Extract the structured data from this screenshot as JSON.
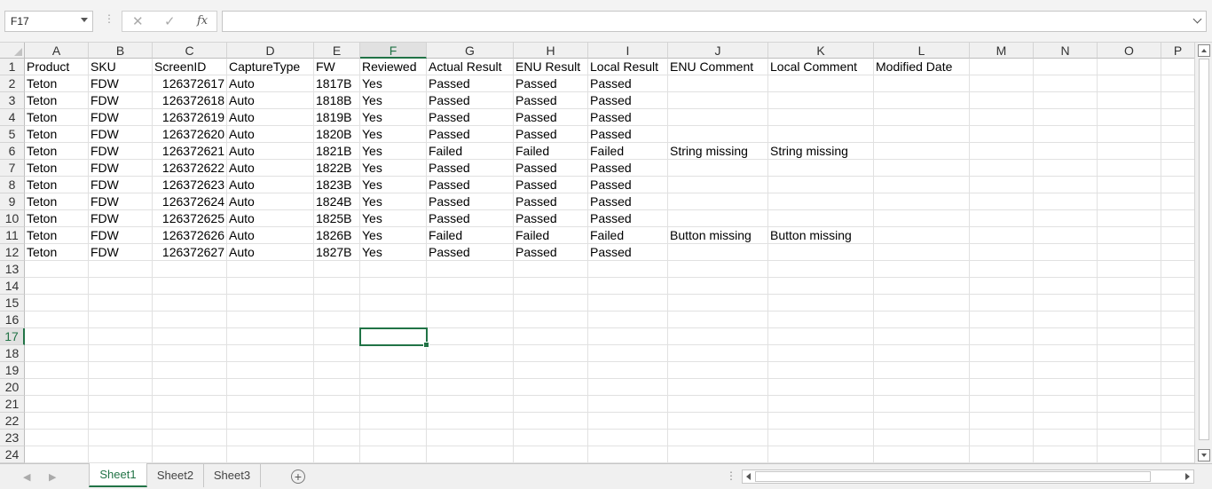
{
  "formula_bar": {
    "name_box": "F17",
    "formula": "",
    "fx_label": "fx",
    "cancel_glyph": "✕",
    "enter_glyph": "✓"
  },
  "columns": [
    "A",
    "B",
    "C",
    "D",
    "E",
    "F",
    "G",
    "H",
    "I",
    "J",
    "K",
    "L",
    "M",
    "N",
    "O",
    "P"
  ],
  "active_column": "F",
  "active_row": 17,
  "row_numbers": [
    1,
    2,
    3,
    4,
    5,
    6,
    7,
    8,
    9,
    10,
    11,
    12,
    13,
    14,
    15,
    16,
    17,
    18,
    19,
    20,
    21,
    22,
    23,
    24
  ],
  "rows": [
    [
      "Product",
      "SKU",
      "ScreenID",
      "CaptureType",
      "FW",
      "Reviewed",
      "Actual Result",
      "ENU Result",
      "Local Result",
      "ENU Comment",
      "Local Comment",
      "Modified Date"
    ],
    [
      "Teton",
      "FDW",
      "126372617",
      "Auto",
      "1817B",
      "Yes",
      "Passed",
      "Passed",
      "Passed",
      "",
      "",
      ""
    ],
    [
      "Teton",
      "FDW",
      "126372618",
      "Auto",
      "1818B",
      "Yes",
      "Passed",
      "Passed",
      "Passed",
      "",
      "",
      ""
    ],
    [
      "Teton",
      "FDW",
      "126372619",
      "Auto",
      "1819B",
      "Yes",
      "Passed",
      "Passed",
      "Passed",
      "",
      "",
      ""
    ],
    [
      "Teton",
      "FDW",
      "126372620",
      "Auto",
      "1820B",
      "Yes",
      "Passed",
      "Passed",
      "Passed",
      "",
      "",
      ""
    ],
    [
      "Teton",
      "FDW",
      "126372621",
      "Auto",
      "1821B",
      "Yes",
      "Failed",
      "Failed",
      "Failed",
      "String missing",
      "String missing",
      ""
    ],
    [
      "Teton",
      "FDW",
      "126372622",
      "Auto",
      "1822B",
      "Yes",
      "Passed",
      "Passed",
      "Passed",
      "",
      "",
      ""
    ],
    [
      "Teton",
      "FDW",
      "126372623",
      "Auto",
      "1823B",
      "Yes",
      "Passed",
      "Passed",
      "Passed",
      "",
      "",
      ""
    ],
    [
      "Teton",
      "FDW",
      "126372624",
      "Auto",
      "1824B",
      "Yes",
      "Passed",
      "Passed",
      "Passed",
      "",
      "",
      ""
    ],
    [
      "Teton",
      "FDW",
      "126372625",
      "Auto",
      "1825B",
      "Yes",
      "Passed",
      "Passed",
      "Passed",
      "",
      "",
      ""
    ],
    [
      "Teton",
      "FDW",
      "126372626",
      "Auto",
      "1826B",
      "Yes",
      "Failed",
      "Failed",
      "Failed",
      "Button missing",
      "Button missing",
      ""
    ],
    [
      "Teton",
      "FDW",
      "126372627",
      "Auto",
      "1827B",
      "Yes",
      "Passed",
      "Passed",
      "Passed",
      "",
      "",
      ""
    ]
  ],
  "sheets": [
    "Sheet1",
    "Sheet2",
    "Sheet3"
  ],
  "active_sheet": "Sheet1",
  "colors": {
    "accent": "#217346",
    "header_bg": "#f0f0f0",
    "gridline": "#e1e1e1"
  }
}
